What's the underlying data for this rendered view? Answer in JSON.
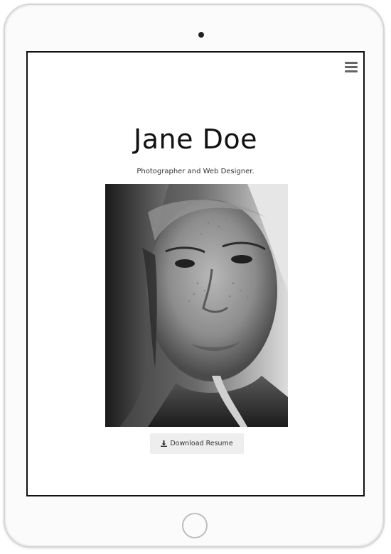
{
  "profile": {
    "name": "Jane Doe",
    "tagline": "Photographer and Web Designer."
  },
  "actions": {
    "download_resume_label": "Download Resume"
  },
  "icons": {
    "menu": "hamburger-menu-icon",
    "download": "download-icon"
  },
  "colors": {
    "screen_background": "#ffffff",
    "button_background": "#eeeeee",
    "text": "#111111"
  }
}
